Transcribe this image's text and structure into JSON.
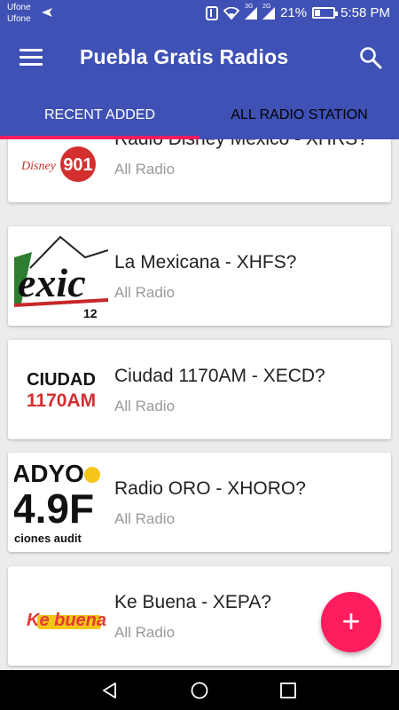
{
  "status_bar": {
    "carrier_1": "Ufone",
    "carrier_2": "Ufone",
    "network_3g": "3G",
    "network_2g": "2G",
    "battery": "21%",
    "time": "5:58 PM"
  },
  "app_bar": {
    "title": "Puebla Gratis Radios",
    "color": "#3F51B5",
    "accent": "#FF1D5E"
  },
  "tabs": [
    {
      "label": "RECENT ADDED",
      "selected": true
    },
    {
      "label": "ALL RADIO STATION",
      "selected": false
    }
  ],
  "stations": [
    {
      "name": "Radio Disney Mexico - XHRS?",
      "category": "All Radio",
      "logo_text": "901"
    },
    {
      "name": "La Mexicana - XHFS?",
      "category": "All Radio",
      "logo_text": "12"
    },
    {
      "name": "Ciudad 1170AM - XECD?",
      "category": "All Radio",
      "logo_text_1": "CIUDAD",
      "logo_text_2": "1170AM"
    },
    {
      "name": "Radio ORO - XHORO?",
      "category": "All Radio",
      "logo_text_1": "ADYO",
      "logo_text_2": "4.9F",
      "logo_text_3": "ciones audit"
    },
    {
      "name": "Ke Buena - XEPA?",
      "category": "All Radio",
      "logo_text": "Ke buena"
    }
  ],
  "fab": {
    "label": "+",
    "icon": "add-icon"
  }
}
